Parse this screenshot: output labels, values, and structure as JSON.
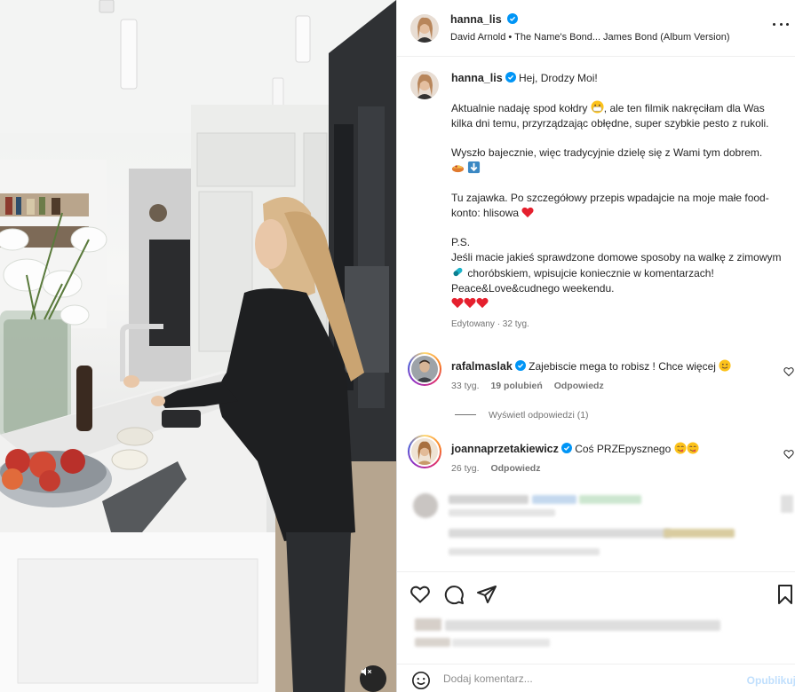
{
  "post": {
    "author": "hanna_lis",
    "audio": "David Arnold • The Name's Bond... James Bond (Album Version)",
    "verified_color": "#0095f6"
  },
  "caption": {
    "author": "hanna_lis",
    "greeting": "Hej, Drodzy Moi!",
    "p1": "Aktualnie nadaję spod kołdry",
    "p1b": ", ale ten filmik nakręciłam dla Was kilka dni temu, przyrządzając obłędne, super szybkie pesto z rukoli.",
    "p2": "Wyszło bajecznie, więc tradycyjnie dzielę się z Wami tym dobrem.",
    "p3": "Tu zajawka. Po szczegółowy przepis wpadajcie na moje małe food-konto: hlisowa",
    "p4_ps": "P.S.",
    "p4a": "Jeśli macie jakieś sprawdzone domowe sposoby na walkę z zimowym",
    "p4b": "choróbskiem, wpisujcie koniecznie w komentarzach!",
    "p4c": "Peace&Love&cudnego weekendu.",
    "edited": "Edytowany · 32 tyg."
  },
  "comments": [
    {
      "user": "rafalmaslak",
      "text": "Zajebiscie mega to robisz ! Chce więcej",
      "time": "33 tyg.",
      "likes": "19 polubień",
      "reply": "Odpowiedz",
      "view_replies": "Wyświetl odpowiedzi (1)"
    },
    {
      "user": "joannaprzetakiewicz",
      "text": "Coś PRZEpysznego",
      "time": "26 tyg.",
      "reply": "Odpowiedz"
    }
  ],
  "add_comment": {
    "placeholder": "Dodaj komentarz...",
    "publish": "Opublikuj"
  },
  "icons": {
    "like": "heart-icon",
    "comment": "comment-icon",
    "share": "share-icon",
    "save": "bookmark-icon",
    "mute": "speaker-muted-icon",
    "emoji": "emoji-icon",
    "more": "more-icon"
  }
}
